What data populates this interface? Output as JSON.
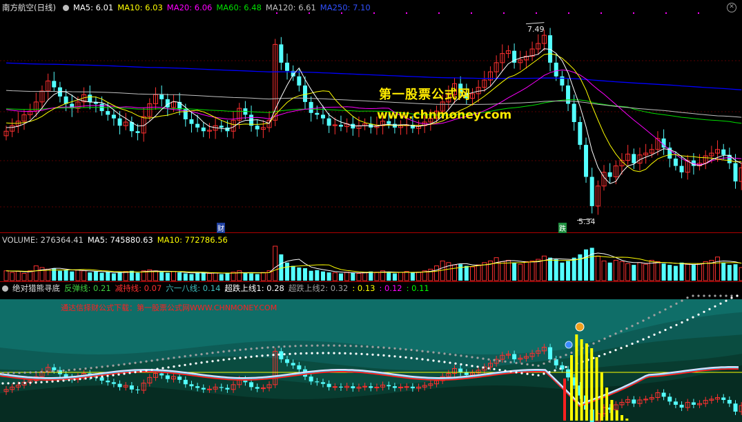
{
  "colors": {
    "up": "#ff3030",
    "down": "#54ffff",
    "ma5": "#ffffff",
    "ma10": "#ffff00",
    "ma20": "#ff00ff",
    "ma60": "#00e000",
    "ma120": "#c0c0c0",
    "ma250": "#0000ff",
    "border": "#b00000",
    "watermark": "#ffeb00"
  },
  "price_pane": {
    "title": "南方航空(日线)",
    "ma_labels": [
      {
        "text": "MA5: 6.01",
        "color": "#ffffff"
      },
      {
        "text": "MA10: 6.03",
        "color": "#ffff00"
      },
      {
        "text": "MA20: 6.06",
        "color": "#ff00ff"
      },
      {
        "text": "MA60: 6.48",
        "color": "#00e000"
      },
      {
        "text": "MA120: 6.61",
        "color": "#c0c0c0"
      },
      {
        "text": "MA250: 7.10",
        "color": "#3050ff"
      }
    ],
    "high_label": "7.49",
    "low_label": "5.34",
    "marker_cai": "财",
    "marker_die": "跌",
    "watermark_name": "第一股票公式网",
    "watermark_url": "www.chnmoney.com",
    "close_icon": "close-icon"
  },
  "volume_pane": {
    "labels": [
      {
        "text": "VOLUME: 276364.41",
        "color": "#d0d0d0"
      },
      {
        "text": "MA5: 745880.63",
        "color": "#ffffff"
      },
      {
        "text": "MA10: 772786.56",
        "color": "#ffff00"
      }
    ]
  },
  "indicator_pane": {
    "title": "绝对猎熊寻底",
    "labels": [
      {
        "text": "反弹线: 0.21",
        "color": "#40d040"
      },
      {
        "text": "减持线: 0.07",
        "color": "#ff3030"
      },
      {
        "text": "六一八线: 0.14",
        "color": "#40c0c0"
      },
      {
        "text": "超跌上线1: 0.28",
        "color": "#ffffff"
      },
      {
        "text": "超跌上线2: 0.32",
        "color": "#a0a0a0"
      },
      {
        "text": ": 0.13",
        "color": "#ffff00"
      },
      {
        "text": ": 0.12",
        "color": "#ff00ff"
      },
      {
        "text": ": 0.11",
        "color": "#00ff00"
      }
    ],
    "banner": "通达信择财公式下载：第一股票公式网WWW.CHNMONEY.COM"
  },
  "chart_data": {
    "type": "candlestick",
    "title": "南方航空(日线)",
    "ylim": [
      5.2,
      7.6
    ],
    "close": [
      6.3,
      6.36,
      6.41,
      6.48,
      6.52,
      6.62,
      6.74,
      6.85,
      6.78,
      6.68,
      6.6,
      6.55,
      6.62,
      6.7,
      6.62,
      6.6,
      6.52,
      6.48,
      6.44,
      6.36,
      6.4,
      6.3,
      6.28,
      6.46,
      6.6,
      6.7,
      6.65,
      6.56,
      6.62,
      6.54,
      6.43,
      6.38,
      6.34,
      6.3,
      6.31,
      6.36,
      6.34,
      6.3,
      6.42,
      6.55,
      6.48,
      6.36,
      6.32,
      6.34,
      6.42,
      7.25,
      7.05,
      6.96,
      6.9,
      6.8,
      6.62,
      6.5,
      6.48,
      6.44,
      6.36,
      6.37,
      6.35,
      6.38,
      6.33,
      6.36,
      6.38,
      6.34,
      6.36,
      6.41,
      6.38,
      6.34,
      6.36,
      6.37,
      6.33,
      6.36,
      6.4,
      6.44,
      6.52,
      6.62,
      6.7,
      6.82,
      6.72,
      6.66,
      6.71,
      6.78,
      6.86,
      6.95,
      7.05,
      7.15,
      7.18,
      7.05,
      7.08,
      7.12,
      7.2,
      7.26,
      7.35,
      7.05,
      6.9,
      6.8,
      6.6,
      6.4,
      6.15,
      5.8,
      5.48,
      5.7,
      5.85,
      5.8,
      5.92,
      5.98,
      6.05,
      5.95,
      6.04,
      6.06,
      6.1,
      6.22,
      6.12,
      6.0,
      5.92,
      5.85,
      5.98,
      5.92,
      5.95,
      6.03,
      6.06,
      6.1,
      6.04,
      5.95,
      5.75,
      5.9
    ]
  },
  "volume_chart_data": {
    "type": "bar",
    "values": [
      0.3,
      0.25,
      0.28,
      0.22,
      0.3,
      0.45,
      0.4,
      0.35,
      0.38,
      0.3,
      0.33,
      0.28,
      0.32,
      0.3,
      0.25,
      0.28,
      0.24,
      0.26,
      0.22,
      0.25,
      0.28,
      0.3,
      0.24,
      0.3,
      0.33,
      0.3,
      0.26,
      0.24,
      0.28,
      0.25,
      0.22,
      0.2,
      0.24,
      0.26,
      0.22,
      0.24,
      0.2,
      0.22,
      0.26,
      0.3,
      0.24,
      0.22,
      0.2,
      0.25,
      0.3,
      1.05,
      0.8,
      0.55,
      0.45,
      0.4,
      0.38,
      0.3,
      0.32,
      0.28,
      0.25,
      0.24,
      0.22,
      0.26,
      0.24,
      0.22,
      0.25,
      0.28,
      0.26,
      0.3,
      0.24,
      0.22,
      0.25,
      0.28,
      0.24,
      0.26,
      0.3,
      0.35,
      0.45,
      0.6,
      0.55,
      0.48,
      0.5,
      0.45,
      0.42,
      0.48,
      0.55,
      0.6,
      0.7,
      0.58,
      0.62,
      0.55,
      0.5,
      0.58,
      0.6,
      0.65,
      0.75,
      0.7,
      0.65,
      0.55,
      0.6,
      0.7,
      0.8,
      0.95,
      1.0,
      0.75,
      0.6,
      0.55,
      0.62,
      0.58,
      0.52,
      0.48,
      0.55,
      0.5,
      0.62,
      0.58,
      0.52,
      0.48,
      0.45,
      0.55,
      0.5,
      0.48,
      0.52,
      0.58,
      0.62,
      0.72,
      0.55,
      0.48,
      0.5,
      0.4
    ]
  }
}
